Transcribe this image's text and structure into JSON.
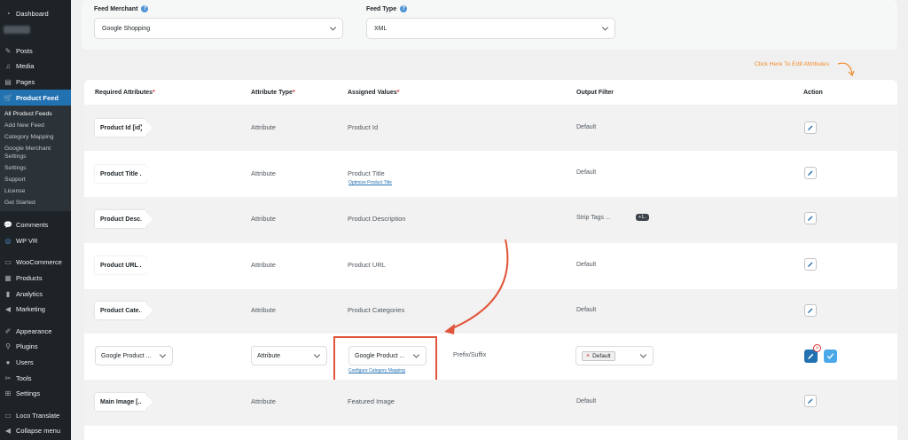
{
  "sidebar": {
    "dashboard": "Dashboard",
    "posts": "Posts",
    "media": "Media",
    "pages": "Pages",
    "product_feed": "Product Feed",
    "submenu": [
      "All Product Feeds",
      "Add New Feed",
      "Category Mapping",
      "Google Merchant",
      "Settings",
      "Settings",
      "Support",
      "License",
      "Get Started"
    ],
    "comments": "Comments",
    "wpvr": "WP VR",
    "woocommerce": "WooCommerce",
    "products": "Products",
    "analytics": "Analytics",
    "marketing": "Marketing",
    "appearance": "Appearance",
    "plugins": "Plugins",
    "users": "Users",
    "tools": "Tools",
    "settings": "Settings",
    "loco": "Loco Translate",
    "collapse": "Collapse menu"
  },
  "filters": {
    "merchant_label": "Feed Merchant",
    "merchant_value": "Google Shopping",
    "type_label": "Feed Type",
    "type_value": "XML"
  },
  "edit_hint": "Click Here To Edit Attributes",
  "headers": {
    "required": "Required Attributes",
    "type": "Attribute Type",
    "assigned": "Assigned Values",
    "filter": "Output Filter",
    "action": "Action",
    "req_mark": "*"
  },
  "rows": [
    {
      "attr": "Product Id [id]",
      "type": "Attribute",
      "value": "Product Id",
      "filter": "Default"
    },
    {
      "attr": "Product Title ...",
      "type": "Attribute",
      "value": "Product Title",
      "link": "Optimize Product Title",
      "filter": "Default"
    },
    {
      "attr": "Product Desc...",
      "type": "Attribute",
      "value": "Product Description",
      "filter": "Strip Tags ...",
      "badge": "+1.."
    },
    {
      "attr": "Product URL ...",
      "type": "Attribute",
      "value": "Product URL",
      "filter": "Default"
    },
    {
      "attr": "Product Cate...",
      "type": "Attribute",
      "value": "Product Categories",
      "filter": "Default"
    },
    {
      "attr": "Main Image [...",
      "type": "Attribute",
      "value": "Featured Image",
      "filter": "Default"
    }
  ],
  "edit_row": {
    "attr": "Google Product ...",
    "type": "Attribute",
    "value": "Google Product ...",
    "link": "Configure Category Mapping",
    "prefix": "Prefix/Suffix",
    "chip": "Default",
    "chip_x": "×"
  },
  "colors": {
    "sidebar_bg": "#1d2327",
    "active": "#2271b1",
    "highlight": "#e0553a",
    "hint": "#f28c28"
  }
}
